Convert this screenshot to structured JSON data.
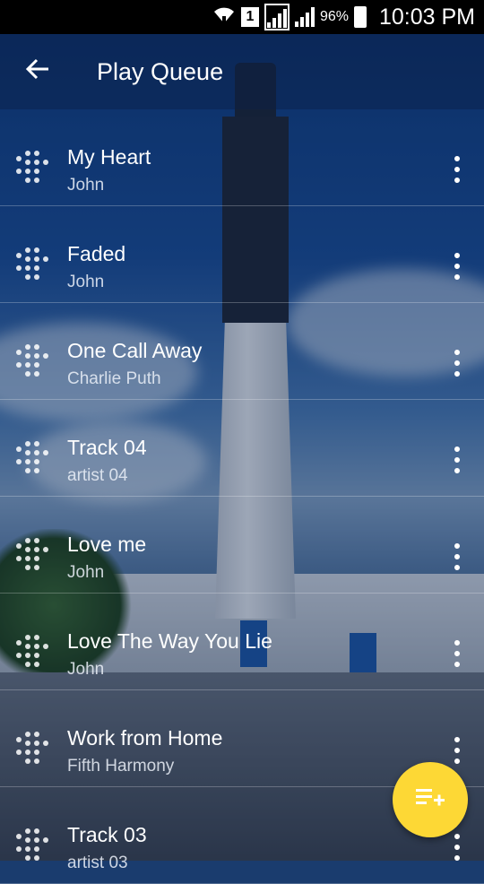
{
  "status_bar": {
    "sim_slot": "1",
    "battery_percent": "96%",
    "time": "10:03 PM"
  },
  "toolbar": {
    "back_icon": "arrow-back-icon",
    "title": "Play Queue"
  },
  "queue": [
    {
      "title": "My Heart",
      "artist": "John"
    },
    {
      "title": "Faded",
      "artist": "John"
    },
    {
      "title": "One Call Away",
      "artist": "Charlie Puth"
    },
    {
      "title": "Track 04",
      "artist": "artist 04"
    },
    {
      "title": "Love me",
      "artist": "John"
    },
    {
      "title": "Love The Way You Lie",
      "artist": "John"
    },
    {
      "title": "Work from Home",
      "artist": "Fifth Harmony"
    },
    {
      "title": "Track 03",
      "artist": "artist 03"
    }
  ],
  "fab": {
    "icon": "playlist-add-icon",
    "color": "#fdd835"
  },
  "colors": {
    "fab": "#fdd835",
    "status_bar": "#000000"
  }
}
